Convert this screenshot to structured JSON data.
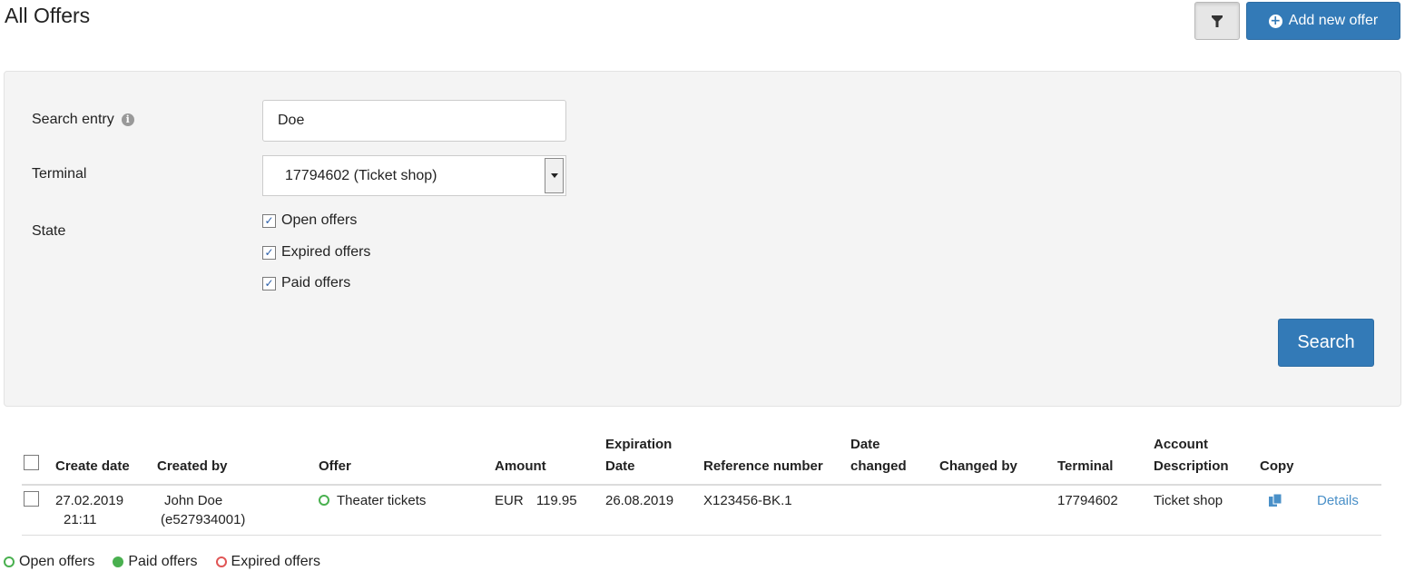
{
  "header": {
    "title": "All Offers",
    "add_button_label": "Add new offer",
    "accent_color": "#337ab7"
  },
  "search_form": {
    "search_entry_label": "Search entry",
    "search_entry_value": "Doe",
    "terminal_label": "Terminal",
    "terminal_value": "17794602 (Ticket shop)",
    "state_label": "State",
    "states": [
      {
        "label": "Open offers",
        "checked": true
      },
      {
        "label": "Expired offers",
        "checked": true
      },
      {
        "label": "Paid offers",
        "checked": true
      }
    ],
    "search_button_label": "Search"
  },
  "table": {
    "headers": {
      "create_date": "Create date",
      "created_by": "Created by",
      "offer": "Offer",
      "amount": "Amount",
      "expiration_date_line1": "Expiration",
      "expiration_date_line2": "Date",
      "reference_number": "Reference number",
      "date_changed_line1": "Date",
      "date_changed_line2": "changed",
      "changed_by": "Changed by",
      "terminal": "Terminal",
      "account_description_line1": "Account",
      "account_description_line2": "Description",
      "copy": "Copy"
    },
    "rows": [
      {
        "create_date": "27.02.2019",
        "create_time": "21:11",
        "created_by_name": "John Doe",
        "created_by_id": "(e527934001)",
        "offer": "Theater tickets",
        "offer_state": "open",
        "currency": "EUR",
        "amount": "119.95",
        "expiration_date": "26.08.2019",
        "reference_number": "X123456-BK.1",
        "date_changed": "",
        "changed_by": "",
        "terminal": "17794602",
        "account_description": "Ticket shop",
        "details_label": "Details"
      }
    ]
  },
  "legend": {
    "open_label": "Open offers",
    "paid_label": "Paid offers",
    "expired_label": "Expired offers",
    "open_color": "#49b04f",
    "paid_color": "#49b04f",
    "expired_color": "#e05555"
  }
}
